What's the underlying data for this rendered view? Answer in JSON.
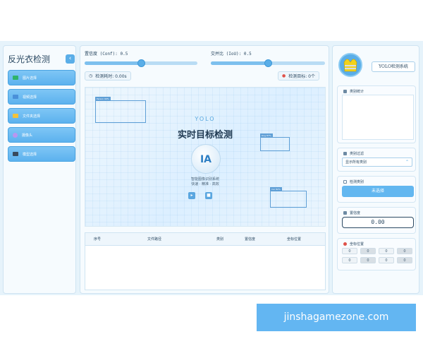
{
  "left": {
    "title": "反光衣检测",
    "collapse_glyph": "‹",
    "nav": [
      {
        "label": "图片选择",
        "icon": "image-icon",
        "color": "#2fb36b"
      },
      {
        "label": "视频选择",
        "icon": "video-icon",
        "color": "#4a90d9"
      },
      {
        "label": "文件夹选择",
        "icon": "folder-icon",
        "color": "#f2c23a"
      },
      {
        "label": "摄像头",
        "icon": "camera-icon",
        "color": "#b896f0"
      },
      {
        "label": "模型选择",
        "icon": "model-icon",
        "color": "#394a5c"
      }
    ]
  },
  "center": {
    "conf_label": "置信度 (Conf): 0.5",
    "iou_label": "交并比 (IoU): 0.5",
    "conf_value": 0.5,
    "iou_value": 0.5,
    "time_label": "检测耗时: 0.00s",
    "targets_label": "检测目标: 0个",
    "view": {
      "brand": "YOLO",
      "title": "实时目标检测",
      "logo_text": "IA",
      "sub1": "智能图像识别系统",
      "sub2": "快速 · 精准 · 高效",
      "boxes": [
        "Person 90%",
        "Dog 87%",
        "Car 82%"
      ]
    },
    "table_headers": [
      "序号",
      "文件路径",
      "类别",
      "置信度",
      "坐标位置"
    ]
  },
  "right": {
    "system_label": "YOLO检测系统",
    "stats_title": "类别统计",
    "filter_title": "类别过滤",
    "filter_value": "显示所有类别",
    "target_title": "检测类别",
    "target_button": "未选择",
    "conf_title": "置信度",
    "conf_display": "0.00",
    "coord_title": "坐标位置",
    "coords": [
      "0",
      "0",
      "0",
      "0",
      "0",
      "0",
      "0",
      "0"
    ]
  },
  "banner": "jinshagamezone.com",
  "colors": {
    "accent": "#5aaee8",
    "vest": "#f2d21b"
  }
}
